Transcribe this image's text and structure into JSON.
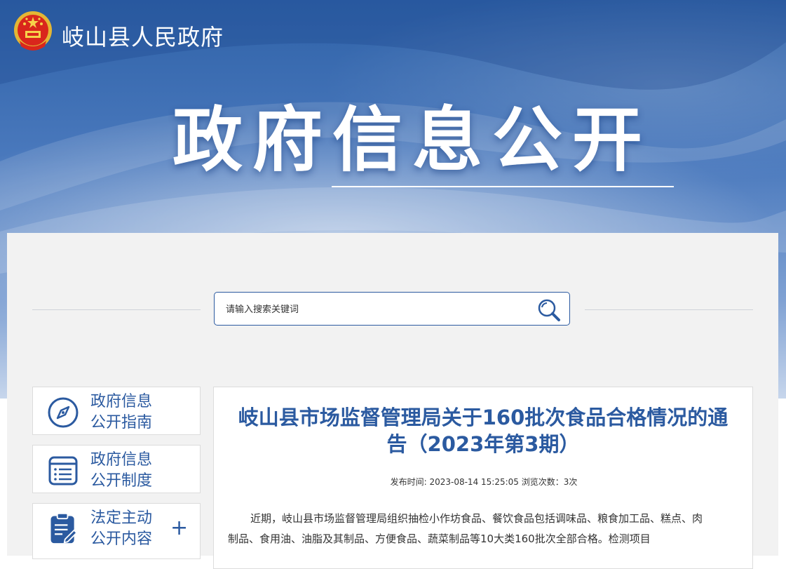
{
  "header": {
    "site_title": "岐山县人民政府",
    "emblem_icon": "national-emblem-icon"
  },
  "hero": {
    "title": "政府信息公开"
  },
  "search": {
    "placeholder": "请输入搜索关键词",
    "button_icon": "search-icon"
  },
  "sidebar": {
    "items": [
      {
        "label": "政府信息公开指南",
        "line1": "政府信息",
        "line2": "公开指南",
        "icon": "compass-icon",
        "expandable": false
      },
      {
        "label": "政府信息公开制度",
        "line1": "政府信息",
        "line2": "公开制度",
        "icon": "document-list-icon",
        "expandable": false
      },
      {
        "label": "法定主动公开内容",
        "line1": "法定主动",
        "line2": "公开内容",
        "icon": "clipboard-edit-icon",
        "expandable": true,
        "expand_symbol": "+"
      }
    ]
  },
  "article": {
    "title": "岐山县市场监督管理局关于160批次食品合格情况的通告（2023年第3期）",
    "meta": "发布时间: 2023-08-14 15:25:05 浏览次数：3次",
    "body": "近期，岐山县市场监督管理局组织抽检小作坊食品、餐饮食品包括调味品、粮食加工品、糕点、肉制品、食用油、油脂及其制品、方便食品、蔬菜制品等10大类160批次全部合格。检测项目"
  },
  "colors": {
    "accent": "#2b5aa0",
    "banner_top": "#2f62a8",
    "panel_bg": "#f2f2f2"
  }
}
